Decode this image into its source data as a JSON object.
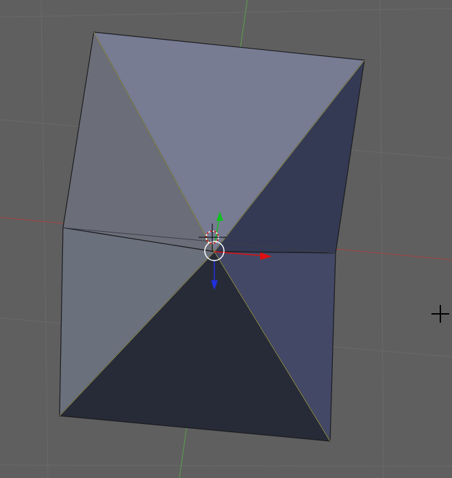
{
  "app": "3d-viewport",
  "colors": {
    "background": "#5f5f5f",
    "grid": "#6a6a6a",
    "axis_x": "#a94444",
    "axis_y": "#5aa14a",
    "face_top": "#777c93",
    "face_left": "#6b6e78",
    "face_right": "#353a54",
    "face_left_lower": "#6b707d",
    "face_bottom": "#272b37",
    "face_right_lower": "#434866",
    "edge": "#1b1b1f",
    "selected_edge": "#c7c56a",
    "gizmo_x": "#e01010",
    "gizmo_y": "#10c020",
    "gizmo_z": "#2030e0",
    "cursor_ring": "#ffffff",
    "crosshair": "#000000"
  },
  "icons": {
    "cursor": "3d-cursor-icon",
    "transform_gizmo": "transform-manipulator-icon",
    "crosshair": "mouse-crosshair-icon"
  }
}
